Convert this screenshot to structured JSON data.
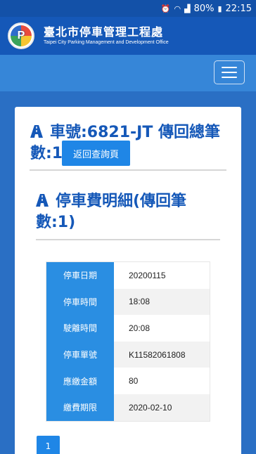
{
  "status": {
    "battery": "80%",
    "time": "22:15"
  },
  "header": {
    "logo_text": "P",
    "title_zh": "臺北市停車管理工程處",
    "title_en": "Taipei City Parking Management and Development Office"
  },
  "main": {
    "title1": "車號:6821-JT 傳回總筆數:1",
    "back_button": "返回查詢頁",
    "title2": "停車費明細(傳回筆數:1)",
    "details": [
      {
        "label": "停車日期",
        "value": "20200115"
      },
      {
        "label": "停車時間",
        "value": "18:08"
      },
      {
        "label": "駛離時間",
        "value": "20:08"
      },
      {
        "label": "停車單號",
        "value": "K11582061808"
      },
      {
        "label": "應繳金額",
        "value": "80"
      },
      {
        "label": "繳費期限",
        "value": "2020-02-10"
      }
    ],
    "page": "1"
  },
  "colors": {
    "brand": "#1558b8",
    "accent": "#1f86e6",
    "label_bg": "#2a8ee2"
  }
}
